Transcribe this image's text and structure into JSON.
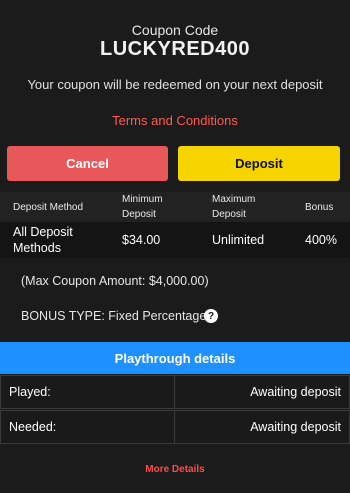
{
  "coupon": {
    "label": "Coupon Code",
    "code": "LUCKYRED400",
    "note": "Your coupon will be redeemed on your next deposit",
    "terms_link": "Terms and Conditions"
  },
  "buttons": {
    "cancel": "Cancel",
    "deposit": "Deposit"
  },
  "table": {
    "headers": {
      "method": "Deposit Method",
      "minimum": "Minimum\nDeposit",
      "maximum": "Maximum\nDeposit",
      "bonus": "Bonus"
    },
    "rows": [
      {
        "method": "All Deposit\nMethods",
        "minimum": "$34.00",
        "maximum": "Unlimited",
        "bonus": "400%"
      }
    ]
  },
  "details": {
    "max_coupon": "(Max Coupon Amount: $4,000.00)",
    "bonus_type": "BONUS TYPE: Fixed Percentage.",
    "help_glyph": "?"
  },
  "playthrough": {
    "title": "Playthrough details",
    "rows": [
      {
        "label": "Played:",
        "value": "Awaiting deposit"
      },
      {
        "label": "Needed:",
        "value": "Awaiting deposit"
      }
    ]
  },
  "more_details": "More Details",
  "colors": {
    "background": "#1b1b1b",
    "cancel": "#e8585a",
    "deposit": "#f5d400",
    "link": "#ff5b4f",
    "playthrough_header": "#1e90ff"
  }
}
